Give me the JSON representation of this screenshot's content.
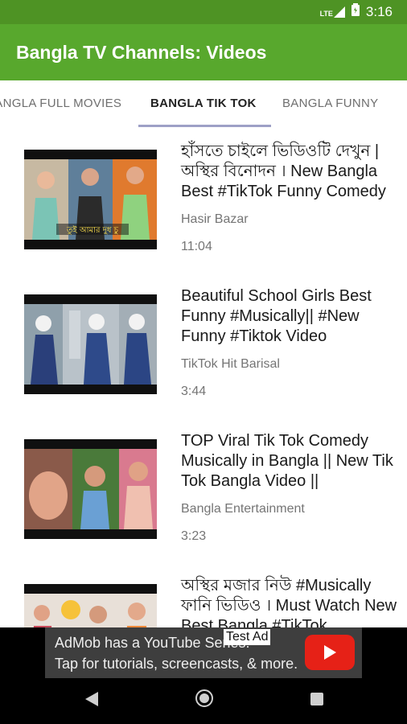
{
  "status_bar": {
    "time": "3:16",
    "network": "LTE"
  },
  "app_bar": {
    "title": "Bangla TV Channels: Videos"
  },
  "tabs": [
    {
      "label": "BANGLA FULL MOVIES",
      "active": false
    },
    {
      "label": "BANGLA TIK TOK",
      "active": true
    },
    {
      "label": "BANGLA FUNNY",
      "active": false
    }
  ],
  "videos": [
    {
      "title": "হাঁসতে চাইলে ভিডিওটি দেখুন | অস্থির বিনোদন । New Bangla Best #TikTok Funny Comedy",
      "channel": "Hasir Bazar",
      "duration": "11:04"
    },
    {
      "title": "Beautiful School  Girls Best Funny #Musically|| #New Funny #Tiktok Video",
      "channel": "TikTok Hit Barisal",
      "duration": "3:44"
    },
    {
      "title": "TOP Viral Tik Tok  Comedy Musically in Bangla || New Tik Tok Bangla Video ||",
      "channel": "Bangla Entertainment",
      "duration": "3:23"
    },
    {
      "title": "অস্থির মজার নিউ #Musically ফানি ভিডিও । Must Watch New Best Bangla #TikTok",
      "channel": "",
      "duration": ""
    }
  ],
  "ad": {
    "label": "Test Ad",
    "line1": "AdMob has a YouTube Series!",
    "line2": "Tap for tutorials, screencasts, & more."
  },
  "colors": {
    "status_bar": "#4e9324",
    "app_bar": "#58a82d",
    "tab_indicator": "#9ea0c6",
    "youtube_red": "#e62117"
  }
}
